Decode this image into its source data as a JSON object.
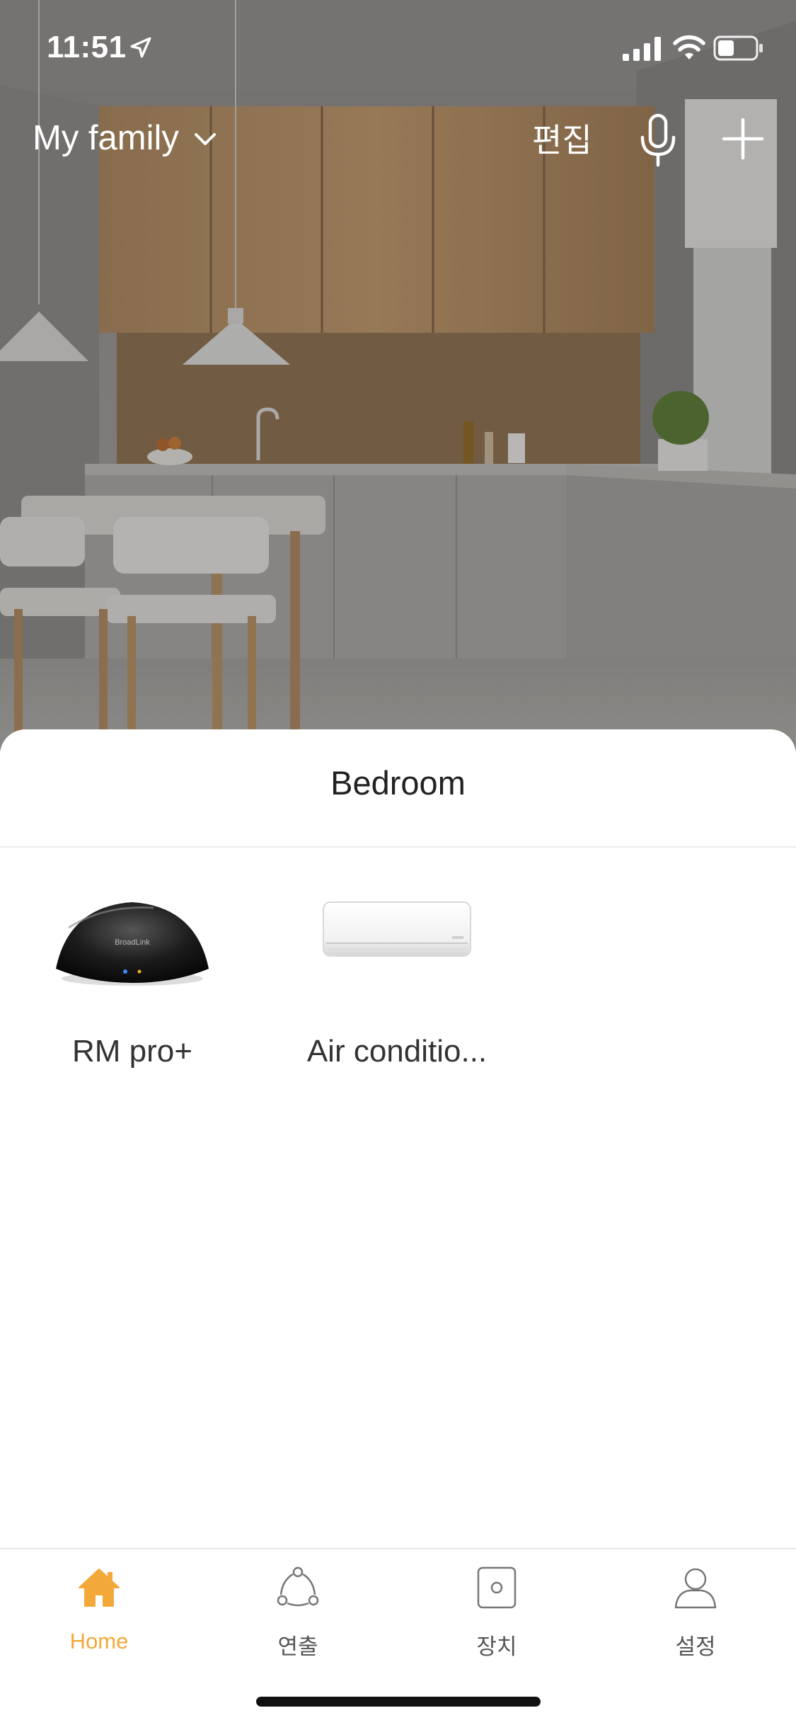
{
  "status_bar": {
    "time": "11:51",
    "icons": [
      "location-arrow-icon",
      "cellular-signal-icon",
      "wifi-icon",
      "battery-icon"
    ]
  },
  "header": {
    "family_name": "My family",
    "edit_label": "편집",
    "icons": [
      "chevron-down-icon",
      "microphone-icon",
      "plus-icon"
    ]
  },
  "room": {
    "title": "Bedroom",
    "devices": [
      {
        "name": "RM pro+",
        "icon": "rm-pro-hub-image"
      },
      {
        "name": "Air conditio...",
        "icon": "air-conditioner-image"
      }
    ]
  },
  "tabs": [
    {
      "label": "Home",
      "icon": "house-icon",
      "active": true
    },
    {
      "label": "연출",
      "icon": "scene-nodes-icon",
      "active": false
    },
    {
      "label": "장치",
      "icon": "device-icon",
      "active": false
    },
    {
      "label": "설정",
      "icon": "user-icon",
      "active": false
    }
  ],
  "colors": {
    "accent": "#f3a93a",
    "text_primary": "#222222",
    "tab_inactive": "#555555",
    "divider": "#ececec"
  }
}
